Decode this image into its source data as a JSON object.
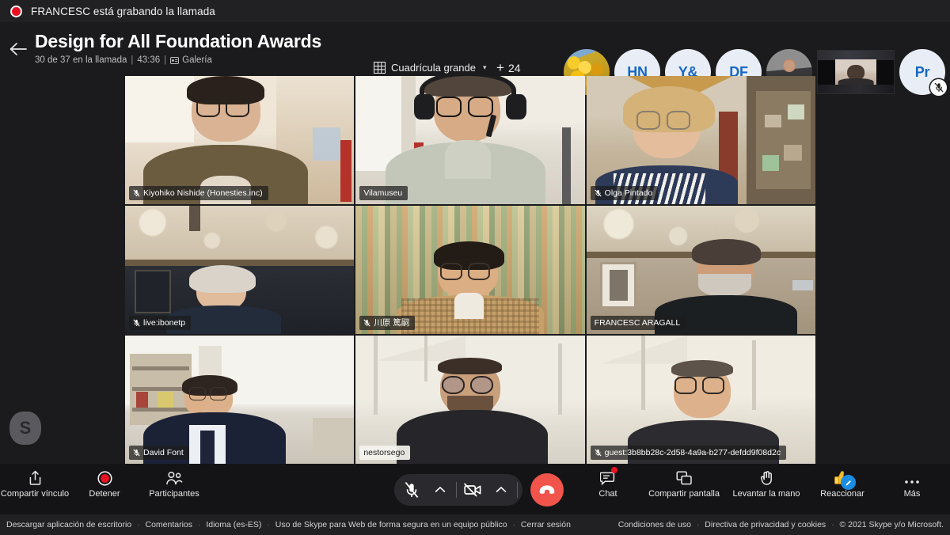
{
  "recording_banner": {
    "text": "FRANCESC está grabando la llamada",
    "icon": "record-dot-icon",
    "dot_color": "#e81123"
  },
  "header": {
    "back_icon": "arrow-left-icon",
    "title": "Design for All Foundation Awards",
    "subtitle": {
      "participants": "30 de 37 en la llamada",
      "duration": "43:36",
      "layout_mode": "Galería",
      "layout_icon": "gallery-icon",
      "separator": "|"
    },
    "layout_picker": {
      "label": "Cuadrícula grande",
      "icon": "grid-icon",
      "chevron": "chevron-down-icon"
    },
    "overflow_participants": {
      "plus": "+",
      "count": "24"
    }
  },
  "avatar_strip": [
    {
      "id": "flowers",
      "kind": "photo-flowers",
      "initials": "",
      "muted": true,
      "sharing": false
    },
    {
      "id": "hn",
      "kind": "initials",
      "initials": "HN",
      "muted": true,
      "sharing": false
    },
    {
      "id": "y-amp",
      "kind": "initials",
      "initials": "Y&",
      "muted": true,
      "sharing": false
    },
    {
      "id": "df",
      "kind": "initials",
      "initials": "DF",
      "muted": true,
      "sharing": false
    },
    {
      "id": "man",
      "kind": "photo-person",
      "initials": "",
      "muted": false,
      "sharing": true
    },
    {
      "id": "selfcam",
      "kind": "self-video",
      "initials": "",
      "muted": false,
      "sharing": false
    },
    {
      "id": "pr",
      "kind": "initials",
      "initials": "Pr",
      "muted": true,
      "sharing": false
    }
  ],
  "watermark": {
    "letter": "S",
    "name": "skype-logo-watermark"
  },
  "grid": {
    "columns": 3,
    "rows": 3,
    "tiles": [
      {
        "name": "Kiyohiko Nishide (Honesties.inc)",
        "muted": true,
        "plate_style": "dark"
      },
      {
        "name": "Vilamuseu",
        "muted": false,
        "plate_style": "dark"
      },
      {
        "name": "Olga Pintado",
        "muted": true,
        "plate_style": "dark"
      },
      {
        "name": "live:ibonetp",
        "muted": true,
        "plate_style": "dark"
      },
      {
        "name": "川原 篤嗣",
        "muted": true,
        "plate_style": "dark"
      },
      {
        "name": "FRANCESC ARAGALL",
        "muted": false,
        "plate_style": "dark"
      },
      {
        "name": "David Font",
        "muted": true,
        "plate_style": "dark"
      },
      {
        "name": "nestorsego",
        "muted": false,
        "plate_style": "light"
      },
      {
        "name": "guest:3b8bb28c-2d58-4a9a-b277-defdd9f08d2c",
        "muted": true,
        "plate_style": "dark"
      }
    ]
  },
  "controls": {
    "left": [
      {
        "label": "Compartir vínculo",
        "icon": "share-link-icon"
      },
      {
        "label": "Detener",
        "icon": "stop-recording-icon",
        "color": "#e81123"
      },
      {
        "label": "Participantes",
        "icon": "people-icon"
      }
    ],
    "center": {
      "mic": {
        "icon": "microphone-off-icon",
        "state": "muted"
      },
      "mic_menu": {
        "icon": "chevron-up-icon"
      },
      "camera": {
        "icon": "camera-off-icon",
        "state": "off"
      },
      "camera_menu": {
        "icon": "chevron-up-icon"
      },
      "hangup": {
        "icon": "end-call-icon",
        "color": "#f1544a"
      }
    },
    "right": [
      {
        "label": "Chat",
        "icon": "chat-icon",
        "badge": true
      },
      {
        "label": "Compartir pantalla",
        "icon": "screen-share-icon"
      },
      {
        "label": "Levantar la mano",
        "icon": "raise-hand-icon"
      },
      {
        "label": "Reaccionar",
        "icon": "thumbs-up-icon",
        "accent": "#1b8ce3"
      },
      {
        "label": "Más",
        "icon": "more-horizontal-icon"
      }
    ]
  },
  "footer": {
    "left_links": [
      "Descargar aplicación de escritorio",
      "Comentarios",
      "Idioma (es-ES)",
      "Uso de Skype para Web de forma segura en un equipo público",
      "Cerrar sesión"
    ],
    "right_links": [
      "Condiciones de uso",
      "Directiva de privacidad y cookies"
    ],
    "copyright": "© 2021 Skype y/o Microsoft.",
    "separator": "·"
  }
}
